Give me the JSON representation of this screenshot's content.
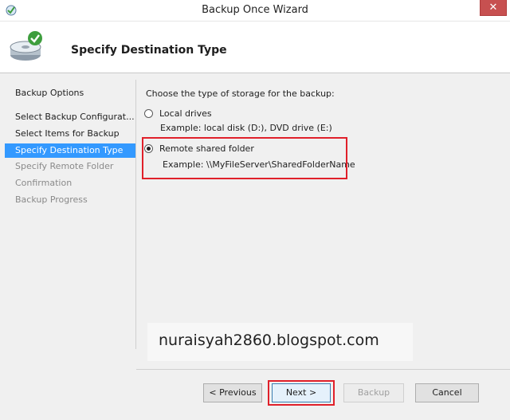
{
  "window": {
    "title": "Backup Once Wizard",
    "close_label": "✕"
  },
  "header": {
    "title": "Specify Destination Type"
  },
  "steps": [
    {
      "label": "Backup Options",
      "state": "normal"
    },
    {
      "label": "Select Backup Configurat...",
      "state": "normal"
    },
    {
      "label": "Select Items for Backup",
      "state": "normal"
    },
    {
      "label": "Specify Destination Type",
      "state": "active"
    },
    {
      "label": "Specify Remote Folder",
      "state": "disabled"
    },
    {
      "label": "Confirmation",
      "state": "disabled"
    },
    {
      "label": "Backup Progress",
      "state": "disabled"
    }
  ],
  "content": {
    "prompt": "Choose the type of storage for the backup:",
    "options": [
      {
        "label": "Local drives",
        "example": "Example: local disk (D:), DVD drive (E:)",
        "checked": false
      },
      {
        "label": "Remote shared folder",
        "example": "Example: \\\\MyFileServer\\SharedFolderName",
        "checked": true
      }
    ]
  },
  "watermark": "nuraisyah2860.blogspot.com",
  "buttons": {
    "previous": "< Previous",
    "next": "Next >",
    "backup": "Backup",
    "cancel": "Cancel"
  },
  "colors": {
    "active_step": "#3399ff",
    "highlight": "#e0202a",
    "close": "#c75050"
  },
  "icons": {
    "app": "backup-app-icon",
    "wizard": "disk-backup-icon"
  }
}
